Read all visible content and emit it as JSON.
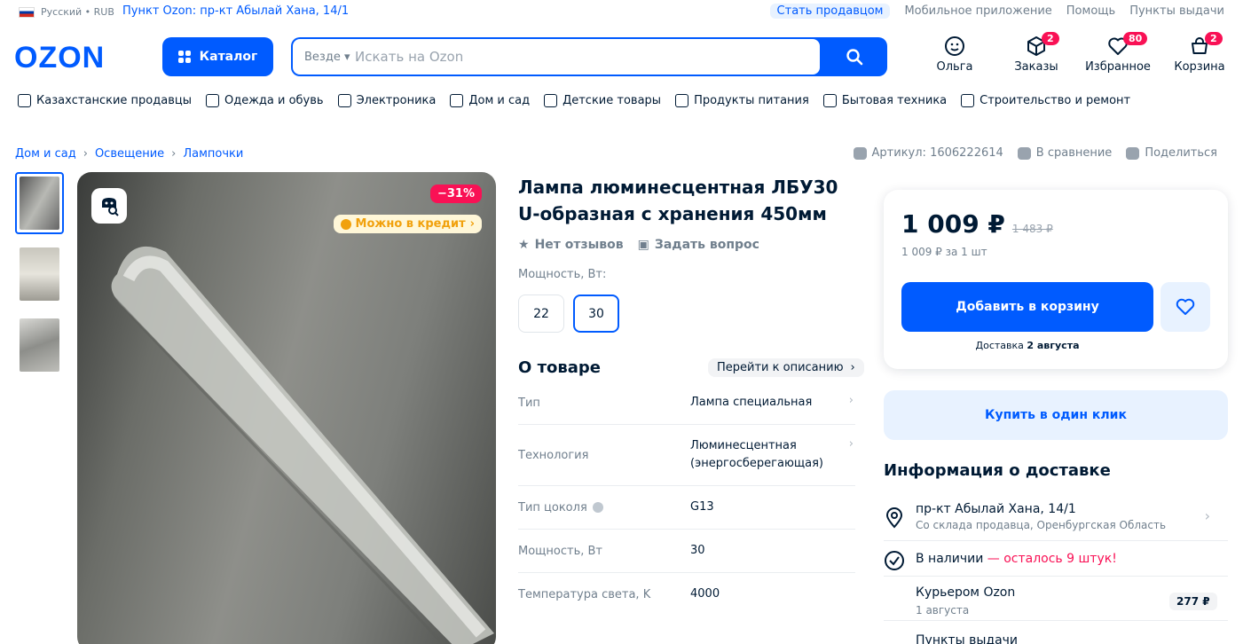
{
  "topbar": {
    "language": "Русский • RUB",
    "pickup": "Пункт Ozon: пр-кт Абылай Хана, 14/1",
    "links": [
      "Стать продавцом",
      "Мобильное приложение",
      "Помощь",
      "Пункты выдачи"
    ]
  },
  "header": {
    "logo": "OZON",
    "catalog": "Каталог",
    "search_scope": "Везде",
    "search_placeholder": "Искать на Ozon",
    "icons": [
      {
        "label": "Ольга",
        "icon": "user-face-icon",
        "badge": ""
      },
      {
        "label": "Заказы",
        "icon": "box-icon",
        "badge": "2"
      },
      {
        "label": "Избранное",
        "icon": "heart-icon",
        "badge": "80"
      },
      {
        "label": "Корзина",
        "icon": "bag-icon",
        "badge": "2"
      }
    ]
  },
  "nav": [
    "Казахстанские продавцы",
    "Одежда и обувь",
    "Электроника",
    "Дом и сад",
    "Детские товары",
    "Продукты питания",
    "Бытовая техника",
    "Строительство и ремонт"
  ],
  "breadcrumbs": [
    "Дом и сад",
    "Освещение",
    "Лампочки"
  ],
  "meta": {
    "article": "Артикул: 1606222614",
    "compare": "В сравнение",
    "share": "Поделиться"
  },
  "gallery": {
    "discount": "−31%",
    "credit": "Можно в кредит"
  },
  "product": {
    "title": "Лампа люминесцентная ЛБУ30 U-образная с хранения 450мм",
    "reviews": "Нет отзывов",
    "ask": "Задать вопрос",
    "power_label": "Мощность, Вт:",
    "power_options": [
      "22",
      "30"
    ],
    "power_selected": "30",
    "about": "О товаре",
    "to_description": "Перейти к описанию",
    "specs": [
      {
        "key": "Тип",
        "value": "Лампа специальная"
      },
      {
        "key": "Технология",
        "value": "Люминесцентная (энергосберегающая)"
      },
      {
        "key": "Тип цоколя",
        "value": "G13"
      },
      {
        "key": "Мощность, Вт",
        "value": "30"
      },
      {
        "key": "Температура света, K",
        "value": "4000"
      }
    ]
  },
  "buy": {
    "price": "1 009 ₽",
    "old_price": "1 483 ₽",
    "per_unit": "1 009 ₽ за 1 шт",
    "add_to_cart": "Добавить в корзину",
    "delivery_prefix": "Доставка",
    "delivery_date": "2 августа",
    "one_click": "Купить в один клик"
  },
  "delivery_info": {
    "title": "Информация о доставке",
    "address": "пр-кт Абылай Хана, 14/1",
    "warehouse": "Со склада продавца, Оренбургская Область",
    "in_stock": "В наличии",
    "stock_left": "— осталось 9 штук!",
    "courier": "Курьером Ozon",
    "courier_date": "1 августа",
    "courier_price": "277 ₽",
    "pickup_points": "Пункты выдачи"
  },
  "colors": {
    "brand": "#005bff",
    "accent": "#f91155",
    "credit": "#f1a10d"
  }
}
